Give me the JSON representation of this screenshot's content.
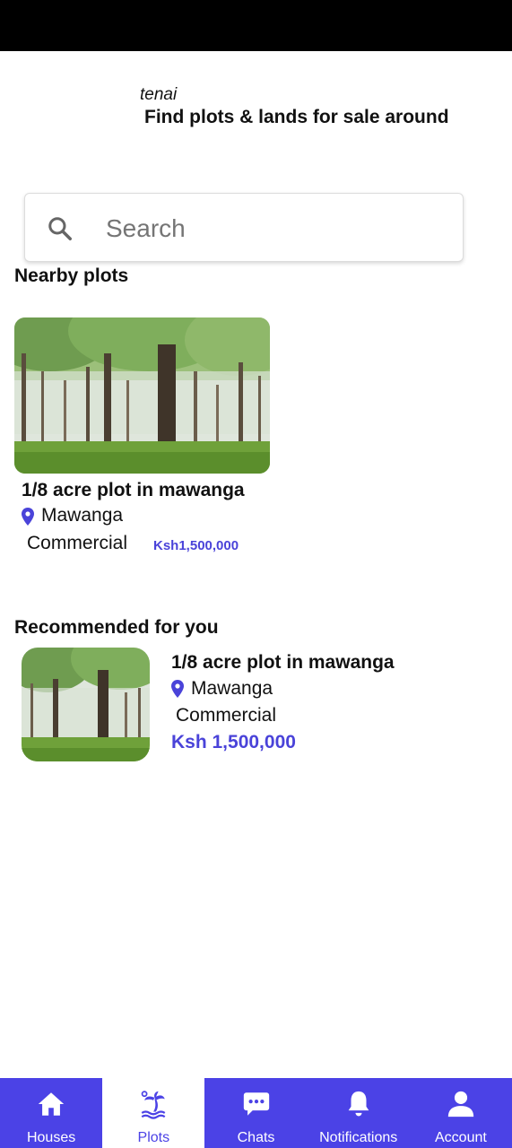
{
  "header": {
    "brand": "tenai",
    "tagline": "Find plots & lands for sale around"
  },
  "search": {
    "placeholder": "Search",
    "icon": "search-icon"
  },
  "nearby": {
    "title": "Nearby plots",
    "cards": [
      {
        "title": "1/8 acre plot in mawanga",
        "location": "Mawanga",
        "type": "Commercial",
        "price": "Ksh1,500,000"
      }
    ]
  },
  "recommended": {
    "title": "Recommended for you",
    "items": [
      {
        "title": "1/8 acre plot in mawanga",
        "location": "Mawanga",
        "type": "Commercial",
        "price": "Ksh 1,500,000"
      }
    ]
  },
  "nav": {
    "items": [
      {
        "label": "Houses",
        "icon": "house-icon"
      },
      {
        "label": "Plots",
        "icon": "palm-island-icon",
        "active": true
      },
      {
        "label": "Chats",
        "icon": "chat-icon"
      },
      {
        "label": "Notifications",
        "icon": "bell-icon"
      },
      {
        "label": "Account",
        "icon": "person-icon"
      }
    ]
  },
  "colors": {
    "accent": "#4b42e6",
    "price": "#4a43d9"
  }
}
